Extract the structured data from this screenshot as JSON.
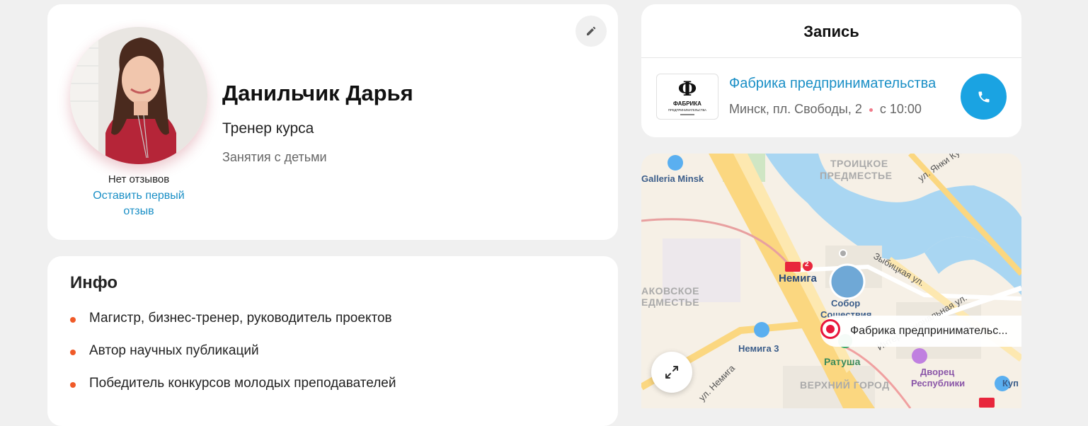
{
  "profile": {
    "name": "Данильчик Дарья",
    "role": "Тренер курса",
    "specialization": "Занятия с детьми",
    "reviews_status": "Нет отзывов",
    "leave_review_link": "Оставить первый отзыв",
    "edit_icon": "pencil-icon"
  },
  "info": {
    "title": "Инфо",
    "items": [
      "Магистр, бизнес-тренер, руководитель проектов",
      "Автор научных публикаций",
      "Победитель конкурсов молодых преподавателей"
    ]
  },
  "booking": {
    "title": "Запись",
    "company": "Фабрика предпринимательства",
    "address": "Минск, пл. Свободы, 2",
    "time": "с 10:00",
    "logo_mark": "Ф",
    "logo_line1": "ФАБРИКА",
    "logo_line2": "ПРЕДПРИНИМАТЕЛЬСТВА",
    "call_icon": "phone-icon",
    "accent_color": "#1aa3e2"
  },
  "map": {
    "labels": {
      "galleria": "Galleria Minsk",
      "troitskoe_1": "ТРОИЦКОЕ",
      "troitskoe_2": "ПРЕДМЕСТЬЕ",
      "yanki_kupaly": "ул. Янки Купалы",
      "zybitskaya": "Зыбицкая ул.",
      "internatsionalnaya": "Интернациональная ул.",
      "metro_nemiga": "Немига",
      "metro_line": "2",
      "sobor_1": "Собор",
      "sobor_2": "Сошествия",
      "rakovskoe_1": "АКОВСКОЕ",
      "rakovskoe_2": "ЕДМЕСТЬЕ",
      "nemiga3": "Немига 3",
      "ratusha": "Ратуша",
      "dvorets_1": "Дворец",
      "dvorets_2": "Республики",
      "verkhniy_gorod": "ВЕРХНИЙ ГОРОД",
      "ul_nemiga": "ул. Немига",
      "kupa": "Куп"
    },
    "pin_label": "Фабрика предпринимательс...",
    "expand_icon": "expand-icon"
  }
}
